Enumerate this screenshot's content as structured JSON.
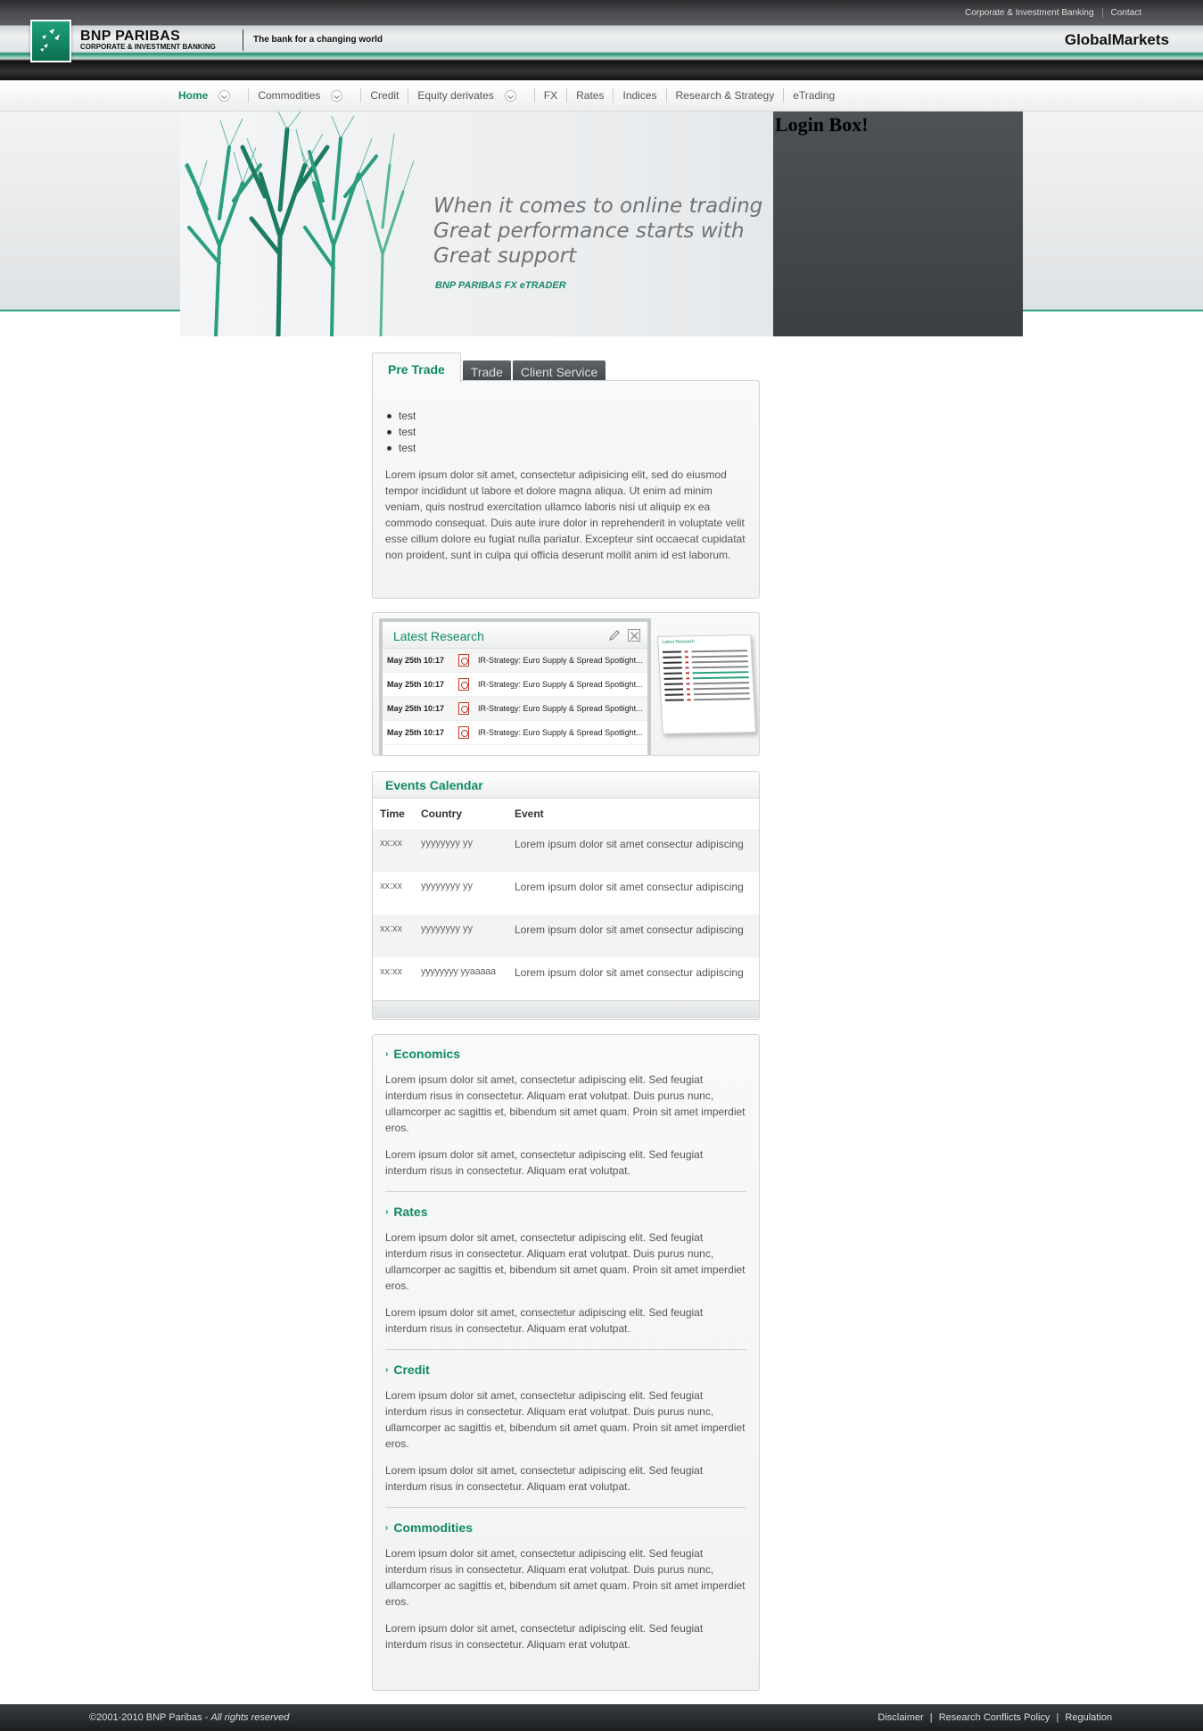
{
  "header": {
    "top_links": [
      "Corporate & Investment Banking",
      "Contact"
    ],
    "brand_name": "BNP PARIBAS",
    "brand_sub": "CORPORATE & INVESTMENT BANKING",
    "tagline": "The bank for a changing world",
    "site_title": "GlobalMarkets"
  },
  "nav": {
    "items": [
      {
        "label": "Home"
      },
      {
        "label": "Commodities"
      },
      {
        "label": "Credit"
      },
      {
        "label": "Equity derivates"
      },
      {
        "label": "FX"
      },
      {
        "label": "Rates"
      },
      {
        "label": "Indices"
      },
      {
        "label": "Research & Strategy"
      },
      {
        "label": "eTrading"
      }
    ]
  },
  "hero": {
    "line1": "When it comes to online trading",
    "line2": "Great performance starts with",
    "line3": "Great support",
    "product": "BNP PARIBAS FX eTRADER"
  },
  "login": {
    "title": "Login Box!"
  },
  "tabs": {
    "items": [
      {
        "label": "Pre Trade"
      },
      {
        "label": "Trade"
      },
      {
        "label": "Client Service"
      }
    ]
  },
  "pre_trade": {
    "bullets": [
      "test",
      "test",
      "test"
    ],
    "text": "Lorem ipsum dolor sit amet, consectetur adipisicing elit, sed do eiusmod tempor incididunt ut labore et dolore magna aliqua. Ut enim ad minim veniam, quis nostrud exercitation ullamco laboris nisi ut aliquip ex ea commodo consequat. Duis aute irure dolor in reprehenderit in voluptate velit esse cillum dolore eu fugiat nulla pariatur. Excepteur sint occaecat cupidatat non proident, sunt in culpa qui officia deserunt mollit anim id est laborum."
  },
  "research": {
    "title": "Latest Research",
    "rows": [
      {
        "date": "May 25th 10:17",
        "title": "IR-Strategy: Euro Supply & Spread Spotlight..."
      },
      {
        "date": "May 25th 10:17",
        "title": "IR-Strategy: Euro Supply & Spread Spotlight..."
      },
      {
        "date": "May 25th 10:17",
        "title": "IR-Strategy: Euro Supply & Spread Spotlight..."
      },
      {
        "date": "May 25th 10:17",
        "title": "IR-Strategy: Euro Supply & Spread Spotlight..."
      }
    ],
    "thumb_title": "Latest Research"
  },
  "events": {
    "title": "Events Calendar",
    "columns": [
      "Time",
      "Country",
      "Event"
    ],
    "rows": [
      {
        "time": "xx:xx",
        "country": "yyyyyyyy yy",
        "event": "Lorem ipsum dolor sit amet consectur adipiscing"
      },
      {
        "time": "xx:xx",
        "country": "yyyyyyyy yy",
        "event": "Lorem ipsum dolor sit amet consectur adipiscing"
      },
      {
        "time": "xx:xx",
        "country": "yyyyyyyy yy",
        "event": "Lorem ipsum dolor sit amet consectur adipiscing"
      },
      {
        "time": "xx:xx",
        "country": "yyyyyyyy yyaaaaa",
        "event": "Lorem ipsum dolor sit amet consectur adipiscing"
      }
    ]
  },
  "accordion": {
    "sections": [
      {
        "title": "Economics",
        "p1": "Lorem ipsum dolor sit amet, consectetur adipiscing elit. Sed feugiat interdum risus in consectetur. Aliquam erat volutpat. Duis purus nunc, ullamcorper ac sagittis et, bibendum sit amet quam. Proin sit amet imperdiet eros.",
        "p2": "Lorem ipsum dolor sit amet, consectetur adipiscing elit. Sed feugiat interdum risus in consectetur. Aliquam erat volutpat."
      },
      {
        "title": "Rates",
        "p1": "Lorem ipsum dolor sit amet, consectetur adipiscing elit. Sed feugiat interdum risus in consectetur. Aliquam erat volutpat. Duis purus nunc, ullamcorper ac sagittis et, bibendum sit amet quam. Proin sit amet imperdiet eros.",
        "p2": "Lorem ipsum dolor sit amet, consectetur adipiscing elit. Sed feugiat interdum risus in consectetur. Aliquam erat volutpat."
      },
      {
        "title": "Credit",
        "p1": "Lorem ipsum dolor sit amet, consectetur adipiscing elit. Sed feugiat interdum risus in consectetur. Aliquam erat volutpat. Duis purus nunc, ullamcorper ac sagittis et, bibendum sit amet quam. Proin sit amet imperdiet eros.",
        "p2": "Lorem ipsum dolor sit amet, consectetur adipiscing elit. Sed feugiat interdum risus in consectetur. Aliquam erat volutpat."
      },
      {
        "title": "Commodities",
        "p1": "Lorem ipsum dolor sit amet, consectetur adipiscing elit. Sed feugiat interdum risus in consectetur. Aliquam erat volutpat. Duis purus nunc, ullamcorper ac sagittis et, bibendum sit amet quam. Proin sit amet imperdiet eros.",
        "p2": "Lorem ipsum dolor sit amet, consectetur adipiscing elit. Sed feugiat interdum risus in consectetur. Aliquam erat volutpat."
      }
    ]
  },
  "footer": {
    "copyright": "©2001-2010 BNP Paribas - ",
    "rights": "All rights reserved",
    "links": [
      "Disclaimer",
      "Research Conflicts Policy",
      "Regulation"
    ],
    "separator": "|"
  },
  "colors": {
    "brand_green": "#0f8a64",
    "accent_line": "#2b9d7c",
    "login_bg": "#43474a",
    "tab_inactive": "#4f5357"
  },
  "icons": {
    "logo": "bnp-stars-logo-icon",
    "nav_dropdown": "chevron-down-icon",
    "research_edit": "pencil-icon",
    "research_close": "close-icon",
    "research_file": "pdf-icon",
    "accordion": "chevron-right-icon"
  }
}
